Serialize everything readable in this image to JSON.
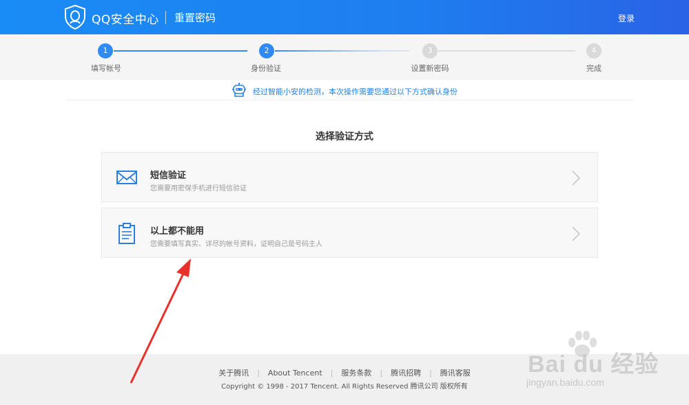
{
  "header": {
    "brand": "QQ安全中心",
    "subtitle": "重置密码",
    "login": "登录"
  },
  "steps": [
    {
      "number": "1",
      "label": "填写帐号",
      "state": "done"
    },
    {
      "number": "2",
      "label": "身份验证",
      "state": "current"
    },
    {
      "number": "3",
      "label": "设置新密码",
      "state": "todo"
    },
    {
      "number": "4",
      "label": "完成",
      "state": "todo"
    }
  ],
  "notice": {
    "text": "经过智能小安的检测，本次操作需要您通过以下方式确认身份",
    "icon": "robot-icon"
  },
  "section_title": "选择验证方式",
  "options": [
    {
      "title": "短信验证",
      "desc": "您需要用密保手机进行短信验证",
      "icon": "envelope-icon"
    },
    {
      "title": "以上都不能用",
      "desc": "您需要填写真实、详尽的帐号资料，证明自己是号码主人",
      "icon": "clipboard-icon"
    }
  ],
  "footer": {
    "links": [
      "关于腾讯",
      "About Tencent",
      "服务条款",
      "腾讯招聘",
      "腾讯客服"
    ],
    "copyright": "Copyright © 1998 - 2017 Tencent. All Rights Reserved 腾讯公司 版权所有"
  },
  "watermark": {
    "main": "Bai du 经验",
    "sub": "jingyan.baidu.com"
  },
  "colors": {
    "accent": "#2f8af5",
    "header_start": "#1a8cf5",
    "header_end": "#2a63e6",
    "annotation": "#e8312a"
  }
}
